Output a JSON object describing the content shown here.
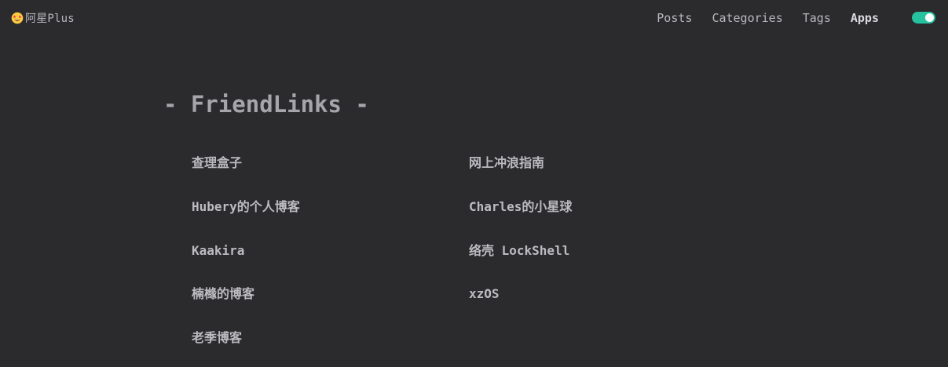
{
  "header": {
    "brand": {
      "emoji": "star-struck-emoji",
      "name": "阿星Plus"
    },
    "nav": [
      {
        "label": "Posts",
        "active": false
      },
      {
        "label": "Categories",
        "active": false
      },
      {
        "label": "Tags",
        "active": false
      },
      {
        "label": "Apps",
        "active": true
      }
    ],
    "theme_toggle": {
      "state": "on",
      "color": "#26c2a0"
    }
  },
  "main": {
    "title": "- FriendLinks -",
    "links": [
      "查理盒子",
      "网上冲浪指南",
      "Hubery的个人博客",
      "Charles的小星球",
      "Kaakira",
      "络壳 LockShell",
      "楠橼的博客",
      "xzOS",
      "老季博客"
    ]
  },
  "colors": {
    "background": "#2b2b2e",
    "text": "#b9b9bd",
    "accent": "#26c2a0"
  }
}
